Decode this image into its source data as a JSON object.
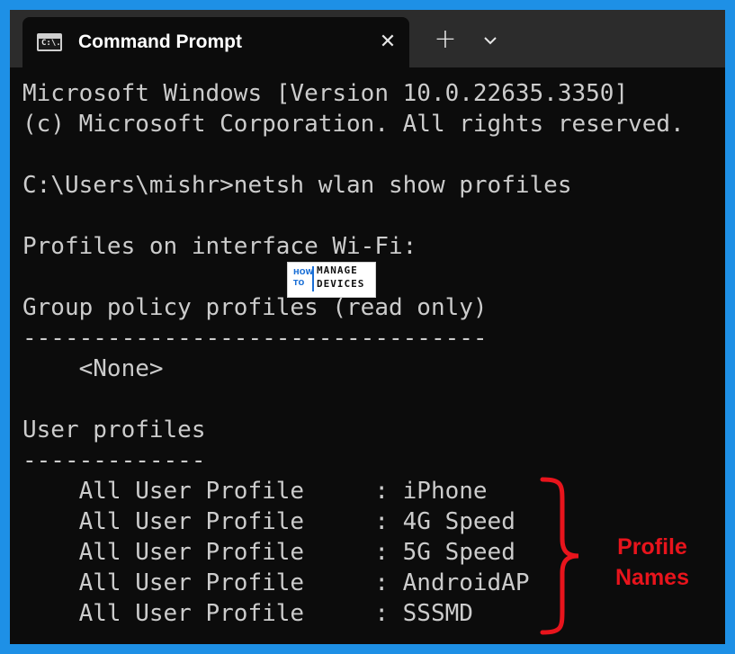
{
  "window": {
    "tab_icon_text": "C:\\.",
    "tab_title": "Command Prompt",
    "close_glyph": "✕",
    "new_tab_glyph": "+",
    "dropdown_icon": "chevron-down-icon"
  },
  "console": {
    "lines": [
      "Microsoft Windows [Version 10.0.22635.3350]",
      "(c) Microsoft Corporation. All rights reserved.",
      "",
      "C:\\Users\\mishr>netsh wlan show profiles",
      "",
      "Profiles on interface Wi-Fi:",
      "",
      "Group policy profiles (read only)",
      "---------------------------------",
      "    <None>",
      "",
      "User profiles",
      "-------------",
      "    All User Profile     : iPhone",
      "    All User Profile     : 4G Speed",
      "    All User Profile     : 5G Speed",
      "    All User Profile     : AndroidAP",
      "    All User Profile     : SSSMD"
    ]
  },
  "watermark": {
    "how": "HOW",
    "to": "TO",
    "manage": "MANAGE",
    "devices": "DEVICES"
  },
  "annotation": {
    "label_line1": "Profile",
    "label_line2": "Names",
    "color": "#e8141c"
  },
  "colors": {
    "border": "#1e90e6",
    "console_bg": "#0c0c0c",
    "console_text": "#cccccc",
    "titlebar": "#2c2c2c"
  }
}
